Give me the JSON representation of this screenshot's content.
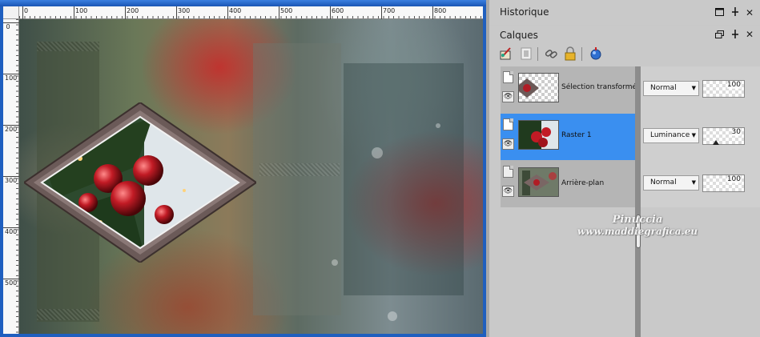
{
  "canvas": {
    "title": "",
    "ruler_top_labels": [
      "0",
      "100",
      "200",
      "300",
      "400",
      "500",
      "600",
      "700",
      "800"
    ],
    "ruler_left_labels": [
      "0",
      "100",
      "200",
      "300",
      "400",
      "500"
    ]
  },
  "history_panel": {
    "title": "Historique"
  },
  "layers_panel": {
    "title": "Calques",
    "layers": [
      {
        "name": "Sélection transformée",
        "blend": "Normal",
        "opacity": "100",
        "selected": false
      },
      {
        "name": "Raster 1",
        "blend": "Luminance",
        "opacity": "30",
        "selected": true
      },
      {
        "name": "Arrière-plan",
        "blend": "Normal",
        "opacity": "100",
        "selected": false
      }
    ]
  },
  "watermark": {
    "line1": "Pinuccia",
    "line2": "www.maddiegrafica.eu"
  },
  "colors": {
    "selection_blue": "#3a8ff0",
    "window_blue": "#1f5fbf",
    "panel_gray": "#c9c9c9"
  }
}
